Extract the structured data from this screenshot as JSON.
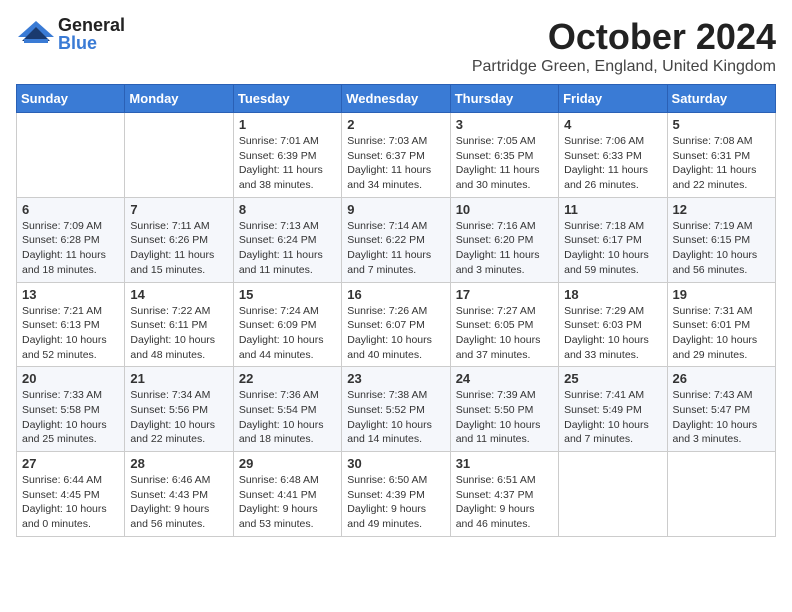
{
  "header": {
    "month_title": "October 2024",
    "location": "Partridge Green, England, United Kingdom",
    "logo_general": "General",
    "logo_blue": "Blue"
  },
  "days_of_week": [
    "Sunday",
    "Monday",
    "Tuesday",
    "Wednesday",
    "Thursday",
    "Friday",
    "Saturday"
  ],
  "weeks": [
    [
      {
        "day": "",
        "info": ""
      },
      {
        "day": "",
        "info": ""
      },
      {
        "day": "1",
        "info": "Sunrise: 7:01 AM\nSunset: 6:39 PM\nDaylight: 11 hours and 38 minutes."
      },
      {
        "day": "2",
        "info": "Sunrise: 7:03 AM\nSunset: 6:37 PM\nDaylight: 11 hours and 34 minutes."
      },
      {
        "day": "3",
        "info": "Sunrise: 7:05 AM\nSunset: 6:35 PM\nDaylight: 11 hours and 30 minutes."
      },
      {
        "day": "4",
        "info": "Sunrise: 7:06 AM\nSunset: 6:33 PM\nDaylight: 11 hours and 26 minutes."
      },
      {
        "day": "5",
        "info": "Sunrise: 7:08 AM\nSunset: 6:31 PM\nDaylight: 11 hours and 22 minutes."
      }
    ],
    [
      {
        "day": "6",
        "info": "Sunrise: 7:09 AM\nSunset: 6:28 PM\nDaylight: 11 hours and 18 minutes."
      },
      {
        "day": "7",
        "info": "Sunrise: 7:11 AM\nSunset: 6:26 PM\nDaylight: 11 hours and 15 minutes."
      },
      {
        "day": "8",
        "info": "Sunrise: 7:13 AM\nSunset: 6:24 PM\nDaylight: 11 hours and 11 minutes."
      },
      {
        "day": "9",
        "info": "Sunrise: 7:14 AM\nSunset: 6:22 PM\nDaylight: 11 hours and 7 minutes."
      },
      {
        "day": "10",
        "info": "Sunrise: 7:16 AM\nSunset: 6:20 PM\nDaylight: 11 hours and 3 minutes."
      },
      {
        "day": "11",
        "info": "Sunrise: 7:18 AM\nSunset: 6:17 PM\nDaylight: 10 hours and 59 minutes."
      },
      {
        "day": "12",
        "info": "Sunrise: 7:19 AM\nSunset: 6:15 PM\nDaylight: 10 hours and 56 minutes."
      }
    ],
    [
      {
        "day": "13",
        "info": "Sunrise: 7:21 AM\nSunset: 6:13 PM\nDaylight: 10 hours and 52 minutes."
      },
      {
        "day": "14",
        "info": "Sunrise: 7:22 AM\nSunset: 6:11 PM\nDaylight: 10 hours and 48 minutes."
      },
      {
        "day": "15",
        "info": "Sunrise: 7:24 AM\nSunset: 6:09 PM\nDaylight: 10 hours and 44 minutes."
      },
      {
        "day": "16",
        "info": "Sunrise: 7:26 AM\nSunset: 6:07 PM\nDaylight: 10 hours and 40 minutes."
      },
      {
        "day": "17",
        "info": "Sunrise: 7:27 AM\nSunset: 6:05 PM\nDaylight: 10 hours and 37 minutes."
      },
      {
        "day": "18",
        "info": "Sunrise: 7:29 AM\nSunset: 6:03 PM\nDaylight: 10 hours and 33 minutes."
      },
      {
        "day": "19",
        "info": "Sunrise: 7:31 AM\nSunset: 6:01 PM\nDaylight: 10 hours and 29 minutes."
      }
    ],
    [
      {
        "day": "20",
        "info": "Sunrise: 7:33 AM\nSunset: 5:58 PM\nDaylight: 10 hours and 25 minutes."
      },
      {
        "day": "21",
        "info": "Sunrise: 7:34 AM\nSunset: 5:56 PM\nDaylight: 10 hours and 22 minutes."
      },
      {
        "day": "22",
        "info": "Sunrise: 7:36 AM\nSunset: 5:54 PM\nDaylight: 10 hours and 18 minutes."
      },
      {
        "day": "23",
        "info": "Sunrise: 7:38 AM\nSunset: 5:52 PM\nDaylight: 10 hours and 14 minutes."
      },
      {
        "day": "24",
        "info": "Sunrise: 7:39 AM\nSunset: 5:50 PM\nDaylight: 10 hours and 11 minutes."
      },
      {
        "day": "25",
        "info": "Sunrise: 7:41 AM\nSunset: 5:49 PM\nDaylight: 10 hours and 7 minutes."
      },
      {
        "day": "26",
        "info": "Sunrise: 7:43 AM\nSunset: 5:47 PM\nDaylight: 10 hours and 3 minutes."
      }
    ],
    [
      {
        "day": "27",
        "info": "Sunrise: 6:44 AM\nSunset: 4:45 PM\nDaylight: 10 hours and 0 minutes."
      },
      {
        "day": "28",
        "info": "Sunrise: 6:46 AM\nSunset: 4:43 PM\nDaylight: 9 hours and 56 minutes."
      },
      {
        "day": "29",
        "info": "Sunrise: 6:48 AM\nSunset: 4:41 PM\nDaylight: 9 hours and 53 minutes."
      },
      {
        "day": "30",
        "info": "Sunrise: 6:50 AM\nSunset: 4:39 PM\nDaylight: 9 hours and 49 minutes."
      },
      {
        "day": "31",
        "info": "Sunrise: 6:51 AM\nSunset: 4:37 PM\nDaylight: 9 hours and 46 minutes."
      },
      {
        "day": "",
        "info": ""
      },
      {
        "day": "",
        "info": ""
      }
    ]
  ]
}
